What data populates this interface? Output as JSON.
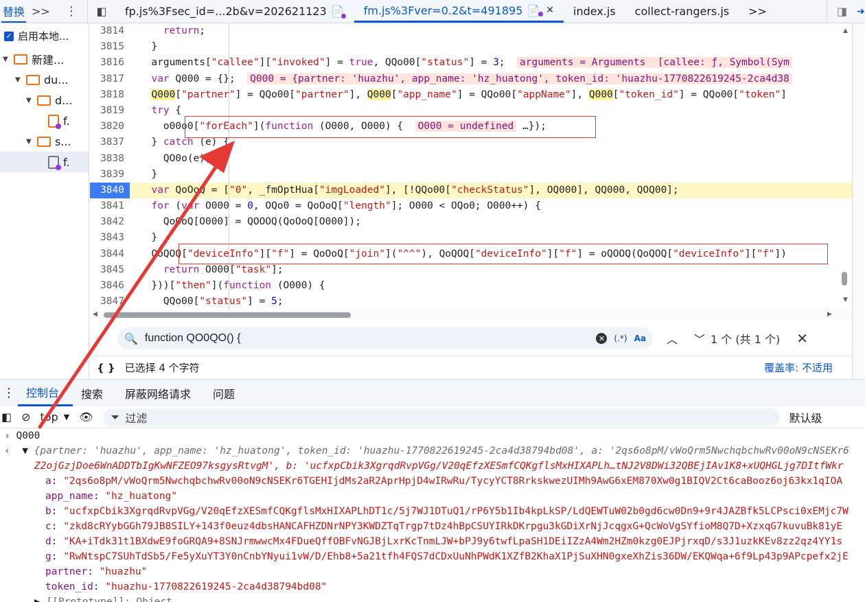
{
  "tabbar": {
    "replace_tab": "替换",
    "more": ">>",
    "tabs": [
      {
        "label": "fp.js%3Fsec_id=...2b&v=202621123"
      },
      {
        "label": "fm.js%3Fver=0.2&t=491895"
      },
      {
        "label": "index.js"
      },
      {
        "label": "collect-rangers.js"
      }
    ],
    "overflow": ">>"
  },
  "sidebar": {
    "checkbox_label": "启用本地...",
    "tree": [
      {
        "label": "新建..."
      },
      {
        "label": "du..."
      },
      {
        "label": "d..."
      },
      {
        "label": "f."
      },
      {
        "label": "s..."
      },
      {
        "label": "f."
      }
    ]
  },
  "editor": {
    "lines": [
      {
        "no": "3814"
      },
      {
        "no": "3815"
      },
      {
        "no": "3816"
      },
      {
        "no": "3817"
      },
      {
        "no": "3818"
      },
      {
        "no": "3819"
      },
      {
        "no": "3820"
      },
      {
        "no": "3837"
      },
      {
        "no": "3838"
      },
      {
        "no": "3839"
      },
      {
        "no": "3840"
      },
      {
        "no": "3841"
      },
      {
        "no": "3842"
      },
      {
        "no": "3843"
      },
      {
        "no": "3844"
      },
      {
        "no": "3845"
      },
      {
        "no": "3846"
      },
      {
        "no": "3847"
      }
    ]
  },
  "search": {
    "value": "function QO0QO() {",
    "regex": "(.*)",
    "case": "Aa",
    "count": "1 个 (共 1 个)"
  },
  "status": {
    "braces": "{ }",
    "selection": "已选择 4 个字符",
    "coverage": "覆盖率: 不适用"
  },
  "drawer": {
    "tabs": [
      {
        "label": "控制台"
      },
      {
        "label": "搜索"
      },
      {
        "label": "屏蔽网络请求"
      },
      {
        "label": "问题"
      }
    ],
    "context": "top",
    "filter_placeholder": "过滤",
    "levels": "默认级"
  },
  "console": {
    "input": "Q000",
    "summary_line1": "{partner: 'huazhu', app_name: 'hz_huatong', token_id: 'huazhu-1770822619245-2ca4d38794bd08', a: '2qs6o8pM/vWoQrm5NwchqbchwRv00oN9cNSEKr6",
    "summary_line2": "Z2ojGzjDoe6WnADDTbIgKwNFZEO97ksgysRtvgM', b: 'ucfxpCbik3XgrqdRvpVGg/V20qEfzXESmfCQKgflsMxHIXAPLh…tNJ2V8DWi32QBEjIAv1K8+xUQHGLjg7DItfWkr",
    "props": [
      {
        "key": "a",
        "value": "\"2qs6o8pM/vWoQrm5NwchqbchwRv00oN9cNSEKr6TGEHIjdMs2aR2AprHpjD4wIRwRu/TycyYCT8RrkskwezUIMh9AwG6xEM870Xw0g1BIQV2Ct6caBooz6oj63kx1qIOA"
      },
      {
        "key": "app_name",
        "value": "\"hz_huatong\""
      },
      {
        "key": "b",
        "value": "\"ucfxpCbik3XgrqdRvpVGg/V20qEfzXESmfCQKgflsMxHIXAPLhDT1c/5j7WJ1DTuQ1/rP6Y5b1Ib4kpLkSP/LdQEWTuW02b0gd6cw0Dn9+9r4JAZBfk5LCPsci0xEMjc7W"
      },
      {
        "key": "c",
        "value": "\"zkd8cRYybGGh79JB8SILY+143f0euz4dbsHANCAFHZDNrNPY3KWDZTqTrgp7tDz4hBpCSUYIRkDKrpgu3kGDiXrNjJcqgxG+QcWoVgSYfioM8Q7D+XzxqG7kuvuBk81yE"
      },
      {
        "key": "d",
        "value": "\"KA+iTdk31t1BXdwE9foGRQA9+8SNJrmwwcMx4FDueQffOBFvNGJBjLxrKcTnmLJW+bPJ9y6twfLpaSH1DEiIZzA4Wm2HZm0kzg0EJPjrxqD/s3J1uzkKEv8zz2qz4YY1s"
      },
      {
        "key": "g",
        "value": "\"RwNtspC7SUhTdSb5/Fe5yXuYT3Y0nCnbYNyui1vW/D/Ehb8+5a21tfh4FQS7dCDxUuNhPWdK1XZfB2KhaX1PjSuXHN0gxeXhZis36DW/EKQWqa+6f9Lp43p9APcpefx2jE"
      },
      {
        "key": "partner",
        "value": "\"huazhu\""
      },
      {
        "key": "token_id",
        "value": "\"huazhu-1770822619245-2ca4d38794bd08\""
      }
    ],
    "proto": "[[Prototype]]: Object"
  },
  "colors": {
    "accent": "#0b57d0",
    "highlight_line": "#fff8c4",
    "annotation_red": "#e53935"
  }
}
